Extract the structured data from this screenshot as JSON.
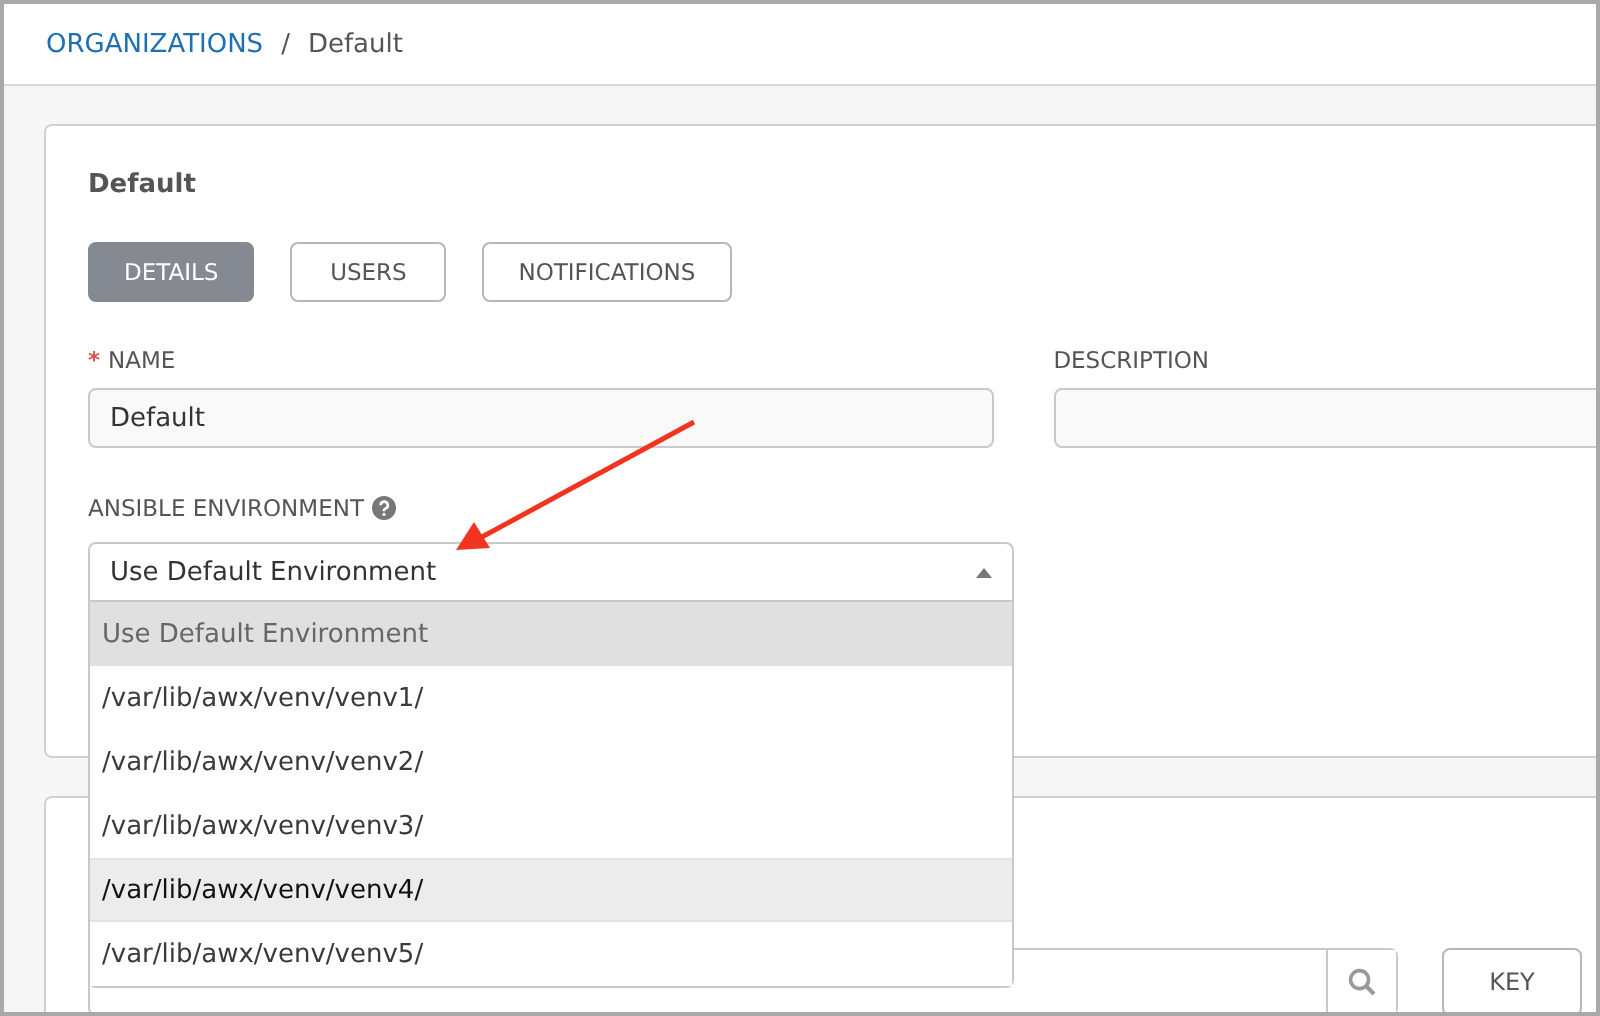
{
  "breadcrumb": {
    "parent": "ORGANIZATIONS",
    "separator": "/",
    "current": "Default"
  },
  "card": {
    "title": "Default",
    "tabs": [
      {
        "label": "DETAILS",
        "selected": true
      },
      {
        "label": "USERS",
        "selected": false
      },
      {
        "label": "NOTIFICATIONS",
        "selected": false
      }
    ],
    "name_field": {
      "label": "NAME",
      "required_mark": "*",
      "value": "Default"
    },
    "description_field": {
      "label": "DESCRIPTION"
    },
    "environment_field": {
      "label": "ANSIBLE ENVIRONMENT",
      "value": "Use Default Environment",
      "expanded": true,
      "options": [
        {
          "label": "Use Default Environment",
          "selected": true,
          "hovered": false
        },
        {
          "label": "/var/lib/awx/venv/venv1/",
          "selected": false,
          "hovered": false
        },
        {
          "label": "/var/lib/awx/venv/venv2/",
          "selected": false,
          "hovered": false
        },
        {
          "label": "/var/lib/awx/venv/venv3/",
          "selected": false,
          "hovered": false
        },
        {
          "label": "/var/lib/awx/venv/venv4/",
          "selected": false,
          "hovered": true
        },
        {
          "label": "/var/lib/awx/venv/venv5/",
          "selected": false,
          "hovered": false
        }
      ]
    }
  },
  "list_card": {
    "key_button": "KEY"
  }
}
